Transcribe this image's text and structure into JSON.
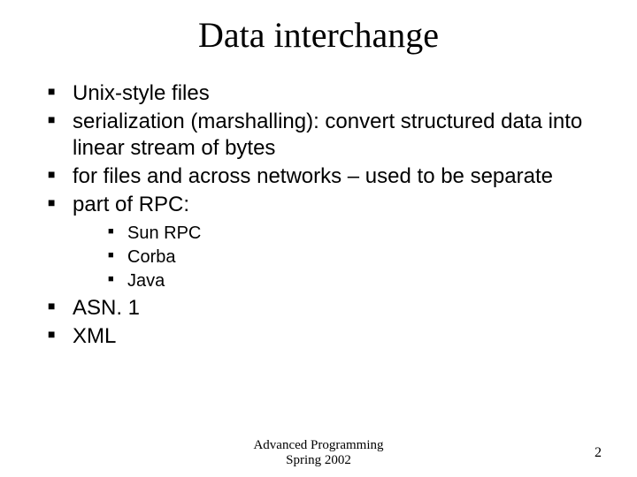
{
  "title": "Data interchange",
  "bullets": [
    {
      "text": "Unix-style files"
    },
    {
      "text": "serialization (marshalling): convert structured data into linear stream of bytes"
    },
    {
      "text": "for files and across networks – used to be separate"
    },
    {
      "text": "part of RPC:",
      "children": [
        {
          "text": "Sun RPC"
        },
        {
          "text": "Corba"
        },
        {
          "text": "Java"
        }
      ]
    },
    {
      "text": "ASN. 1"
    },
    {
      "text": "XML"
    }
  ],
  "footer": {
    "line1": "Advanced Programming",
    "line2": "Spring 2002"
  },
  "page_number": "2"
}
